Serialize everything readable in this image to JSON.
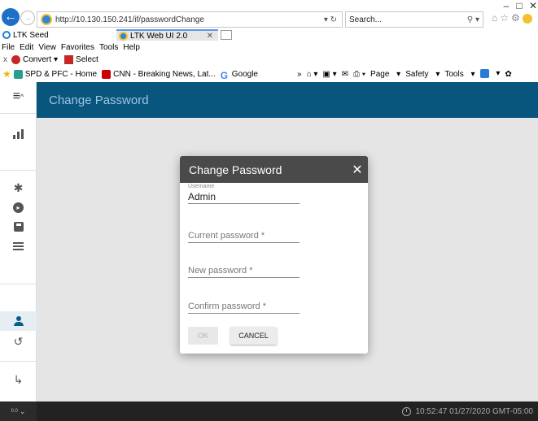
{
  "browser": {
    "address_url": "http://10.130.150.241/if/passwordChange",
    "search_placeholder": "Search...",
    "tabs": [
      {
        "label": "LTK Seed"
      },
      {
        "label": "LTK Web UI 2.0"
      }
    ],
    "menu": [
      "File",
      "Edit",
      "View",
      "Favorites",
      "Tools",
      "Help"
    ],
    "command_bar": {
      "convert": "Convert",
      "select": "Select"
    },
    "favorites": [
      {
        "label": "SPD & PFC - Home"
      },
      {
        "label": "CNN - Breaking News, Lat..."
      },
      {
        "label": "Google"
      }
    ],
    "fav_tools": [
      "Page",
      "Safety",
      "Tools"
    ]
  },
  "app": {
    "page_title": "Change Password",
    "status_time": "10:52:47 01/27/2020 GMT-05:00",
    "version_label": "0.0"
  },
  "dialog": {
    "title": "Change Password",
    "username_label": "Username",
    "username_value": "Admin",
    "current_password_placeholder": "Current password *",
    "new_password_placeholder": "New password *",
    "confirm_password_placeholder": "Confirm password *",
    "ok_label": "OK",
    "cancel_label": "CANCEL"
  },
  "colors": {
    "topbar": "#08557e",
    "dialog_header": "#4a4a4a",
    "background": "#e5e5e5"
  }
}
